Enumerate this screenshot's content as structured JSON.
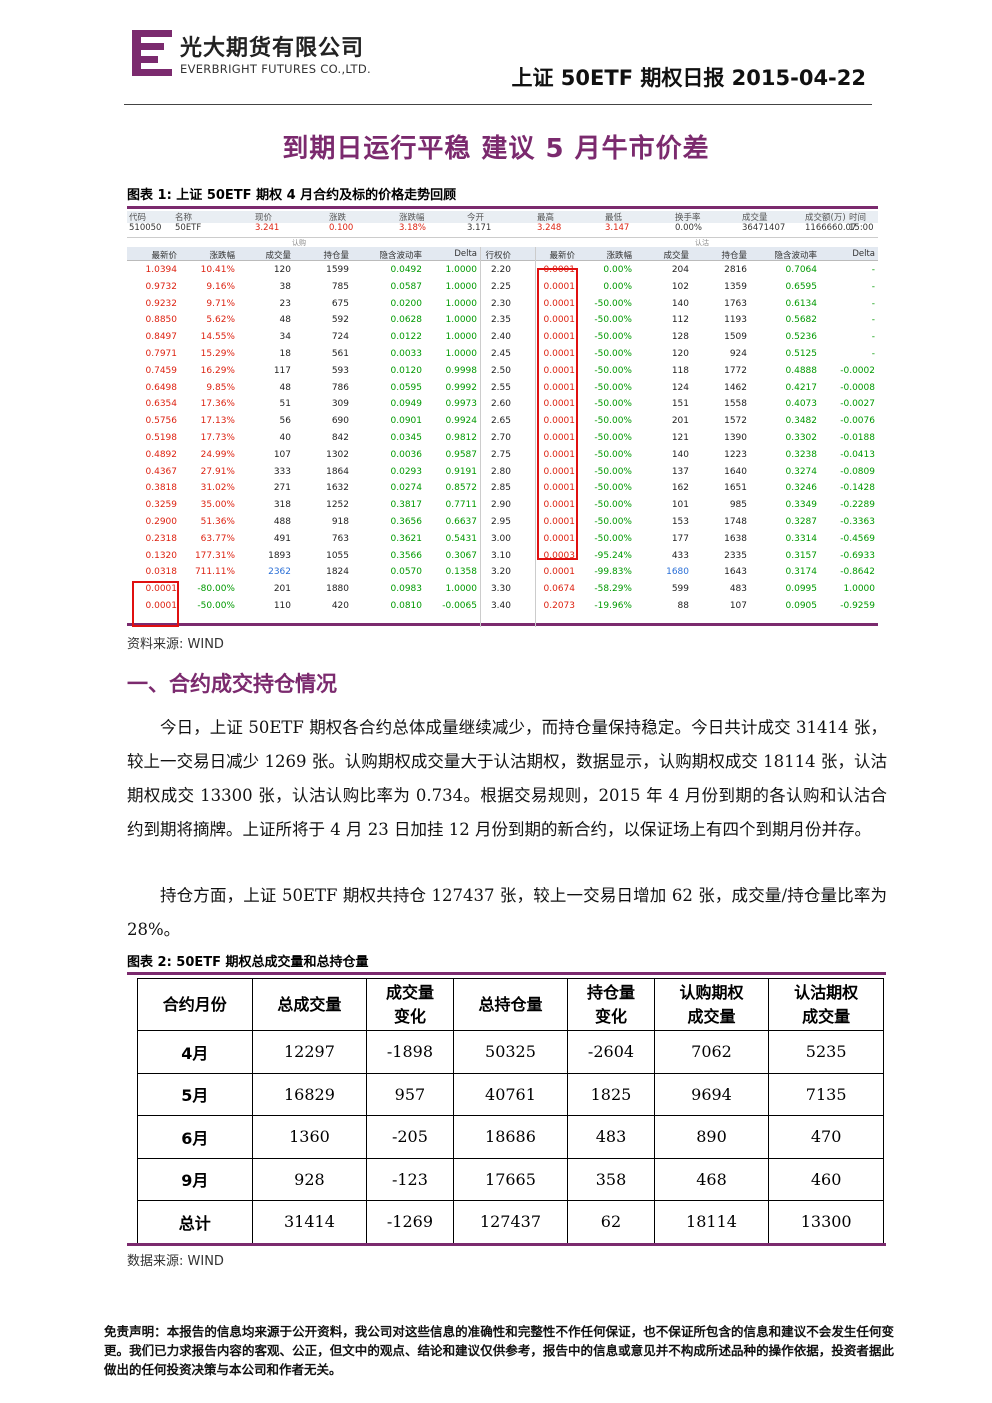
{
  "header": {
    "company_cn": "光大期货有限公司",
    "company_en": "EVERBRIGHT FUTURES CO.,LTD.",
    "report_title": "上证 50ETF 期权日报 2015-04-22",
    "brand_color": "#7b2a6e"
  },
  "headline": "到期日运行平稳 建议 5 月牛市价差",
  "figure1": {
    "caption": "图表 1: 上证 50ETF 期权 4 月合约及标的价格走势回顾",
    "underlying_headers": [
      "代码",
      "名称",
      "现价",
      "涨跌",
      "涨跌幅",
      "今开",
      "最高",
      "最低",
      "换手率",
      "成交量",
      "成交额(万)",
      "时间"
    ],
    "underlying_values": [
      "510050",
      "50ETF",
      "3.241",
      "0.100",
      "3.18%",
      "3.171",
      "3.248",
      "3.147",
      "0.00%",
      "36471407",
      "1166660.07",
      "15:00"
    ],
    "group_call": "认购",
    "group_put": "认沽",
    "col_headers": [
      "最新价",
      "涨跌幅",
      "成交量",
      "持仓量",
      "隐含波动率",
      "Delta",
      "行权价",
      "最新价",
      "涨跌幅",
      "成交量",
      "持仓量",
      "隐含波动率",
      "Delta"
    ],
    "rows": [
      [
        "1.0394",
        "10.41%",
        "120",
        "1599",
        "0.0492",
        "1.0000",
        "2.20",
        "0.0001",
        "0.00%",
        "204",
        "2816",
        "0.7064",
        "-"
      ],
      [
        "0.9732",
        "9.16%",
        "38",
        "785",
        "0.0587",
        "1.0000",
        "2.25",
        "0.0001",
        "0.00%",
        "102",
        "1359",
        "0.6595",
        "-"
      ],
      [
        "0.9232",
        "9.71%",
        "23",
        "675",
        "0.0200",
        "1.0000",
        "2.30",
        "0.0001",
        "-50.00%",
        "140",
        "1763",
        "0.6134",
        "-"
      ],
      [
        "0.8850",
        "5.62%",
        "48",
        "592",
        "0.0628",
        "1.0000",
        "2.35",
        "0.0001",
        "-50.00%",
        "112",
        "1193",
        "0.5682",
        "-"
      ],
      [
        "0.8497",
        "14.55%",
        "34",
        "724",
        "0.0122",
        "1.0000",
        "2.40",
        "0.0001",
        "-50.00%",
        "128",
        "1509",
        "0.5236",
        "-"
      ],
      [
        "0.7971",
        "15.29%",
        "18",
        "561",
        "0.0033",
        "1.0000",
        "2.45",
        "0.0001",
        "-50.00%",
        "120",
        "924",
        "0.5125",
        "-"
      ],
      [
        "0.7459",
        "16.29%",
        "117",
        "593",
        "0.0120",
        "0.9998",
        "2.50",
        "0.0001",
        "-50.00%",
        "118",
        "1772",
        "0.4888",
        "-0.0002"
      ],
      [
        "0.6498",
        "9.85%",
        "48",
        "786",
        "0.0595",
        "0.9992",
        "2.55",
        "0.0001",
        "-50.00%",
        "124",
        "1462",
        "0.4217",
        "-0.0008"
      ],
      [
        "0.6354",
        "17.36%",
        "51",
        "309",
        "0.0949",
        "0.9973",
        "2.60",
        "0.0001",
        "-50.00%",
        "151",
        "1558",
        "0.4073",
        "-0.0027"
      ],
      [
        "0.5756",
        "17.13%",
        "56",
        "690",
        "0.0901",
        "0.9924",
        "2.65",
        "0.0001",
        "-50.00%",
        "201",
        "1572",
        "0.3482",
        "-0.0076"
      ],
      [
        "0.5198",
        "17.73%",
        "40",
        "842",
        "0.0345",
        "0.9812",
        "2.70",
        "0.0001",
        "-50.00%",
        "121",
        "1390",
        "0.3302",
        "-0.0188"
      ],
      [
        "0.4892",
        "24.99%",
        "107",
        "1302",
        "0.0036",
        "0.9587",
        "2.75",
        "0.0001",
        "-50.00%",
        "140",
        "1223",
        "0.3238",
        "-0.0413"
      ],
      [
        "0.4367",
        "27.91%",
        "333",
        "1864",
        "0.0293",
        "0.9191",
        "2.80",
        "0.0001",
        "-50.00%",
        "137",
        "1640",
        "0.3274",
        "-0.0809"
      ],
      [
        "0.3818",
        "31.02%",
        "271",
        "1632",
        "0.0274",
        "0.8572",
        "2.85",
        "0.0001",
        "-50.00%",
        "162",
        "1651",
        "0.3246",
        "-0.1428"
      ],
      [
        "0.3259",
        "35.00%",
        "318",
        "1252",
        "0.3817",
        "0.7711",
        "2.90",
        "0.0001",
        "-50.00%",
        "101",
        "985",
        "0.3349",
        "-0.2289"
      ],
      [
        "0.2900",
        "51.36%",
        "488",
        "918",
        "0.3656",
        "0.6637",
        "2.95",
        "0.0001",
        "-50.00%",
        "153",
        "1748",
        "0.3287",
        "-0.3363"
      ],
      [
        "0.2318",
        "63.77%",
        "491",
        "763",
        "0.3621",
        "0.5431",
        "3.00",
        "0.0001",
        "-50.00%",
        "177",
        "1638",
        "0.3314",
        "-0.4569"
      ],
      [
        "0.1320",
        "177.31%",
        "1893",
        "1055",
        "0.3566",
        "0.3067",
        "3.10",
        "0.0003",
        "-95.24%",
        "433",
        "2335",
        "0.3157",
        "-0.6933"
      ],
      [
        "0.0318",
        "711.11%",
        "2362",
        "1824",
        "0.0570",
        "0.1358",
        "3.20",
        "0.0001",
        "-99.83%",
        "1680",
        "1643",
        "0.3174",
        "-0.8642"
      ],
      [
        "0.0001",
        "-80.00%",
        "201",
        "1880",
        "0.0983",
        "1.0000",
        "3.30",
        "0.0674",
        "-58.29%",
        "599",
        "483",
        "0.0995",
        "1.0000"
      ],
      [
        "0.0001",
        "-50.00%",
        "110",
        "420",
        "0.0810",
        "-0.0065",
        "3.40",
        "0.2073",
        "-19.96%",
        "88",
        "107",
        "0.0905",
        "-0.9259"
      ]
    ],
    "source": "资料来源: WIND"
  },
  "section1": {
    "title": "一、合约成交持仓情况",
    "para1": "今日，上证 50ETF 期权各合约总体成量继续减少，而持仓量保持稳定。今日共计成交 31414 张，较上一交易日减少 1269 张。认购期权成交量大于认沽期权，数据显示，认购期权成交 18114 张，认沽期权成交 13300 张，认沽认购比率为 0.734。根据交易规则，2015 年 4 月份到期的各认购和认沽合约到期将摘牌。上证所将于 4 月 23 日加挂 12 月份到期的新合约，以保证场上有四个到期月份并存。",
    "para2": "持仓方面，上证 50ETF 期权共持仓 127437 张，较上一交易日增加 62 张，成交量/持仓量比率为 28%。"
  },
  "figure2": {
    "caption": "图表 2: 50ETF 期权总成交量和总持仓量",
    "headers": [
      {
        "l1": "合约月份",
        "l2": ""
      },
      {
        "l1": "总成交量",
        "l2": ""
      },
      {
        "l1": "成交量",
        "l2": "变化"
      },
      {
        "l1": "总持仓量",
        "l2": ""
      },
      {
        "l1": "持仓量",
        "l2": "变化"
      },
      {
        "l1": "认购期权",
        "l2": "成交量"
      },
      {
        "l1": "认沽期权",
        "l2": "成交量"
      }
    ],
    "rows": [
      [
        "4月",
        "12297",
        "-1898",
        "50325",
        "-2604",
        "7062",
        "5235"
      ],
      [
        "5月",
        "16829",
        "957",
        "40761",
        "1825",
        "9694",
        "7135"
      ],
      [
        "6月",
        "1360",
        "-205",
        "18686",
        "483",
        "890",
        "470"
      ],
      [
        "9月",
        "928",
        "-123",
        "17665",
        "358",
        "468",
        "460"
      ],
      [
        "总计",
        "31414",
        "-1269",
        "127437",
        "62",
        "18114",
        "13300"
      ]
    ],
    "source": "数据来源: WIND"
  },
  "disclaimer": "免责声明：本报告的信息均来源于公开资料，我公司对这些信息的准确性和完整性不作任何保证，也不保证所包含的信息和建议不会发生任何变更。我们已力求报告内容的客观、公正，但文中的观点、结论和建议仅供参考，报告中的信息或意见并不构成所述品种的操作依据，投资者据此做出的任何投资决策与本公司和作者无关。"
}
